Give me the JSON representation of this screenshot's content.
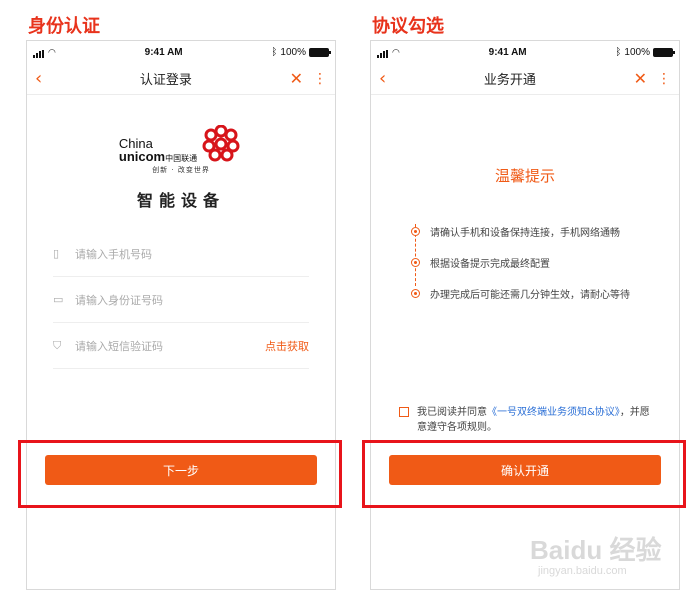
{
  "sections": {
    "left_title": "身份认证",
    "right_title": "协议勾选"
  },
  "status_bar": {
    "time": "9:41 AM",
    "battery": "100%",
    "battery_level": 1.0
  },
  "left_screen": {
    "nav_title": "认证登录",
    "logo": {
      "line1": "China",
      "line2": "unicom",
      "line2_cn": "中国联通",
      "slogan": "创新 · 改变世界"
    },
    "device_title": "智能设备",
    "fields": [
      {
        "icon": "phone-icon",
        "placeholder": "请输入手机号码"
      },
      {
        "icon": "id-card-icon",
        "placeholder": "请输入身份证号码"
      },
      {
        "icon": "shield-icon",
        "placeholder": "请输入短信验证码",
        "action": "点击获取"
      }
    ],
    "next_button": "下一步"
  },
  "right_screen": {
    "nav_title": "业务开通",
    "tip_title": "温馨提示",
    "steps": [
      "请确认手机和设备保持连接，手机网络通畅",
      "根据设备提示完成最终配置",
      "办理完成后可能还需几分钟生效，请耐心等待"
    ],
    "agreement": {
      "prefix": "我已阅读并同意",
      "link": "《一号双终端业务须知&协议》",
      "suffix": "，并愿意遵守各项规则。"
    },
    "confirm_button": "确认开通"
  },
  "watermark": {
    "brand": "Baidu 经验",
    "url": "jingyan.baidu.com"
  },
  "colors": {
    "accent": "#f05a16",
    "highlight": "#e8141b",
    "title_red": "#e8331c",
    "link": "#2b6fd6"
  }
}
